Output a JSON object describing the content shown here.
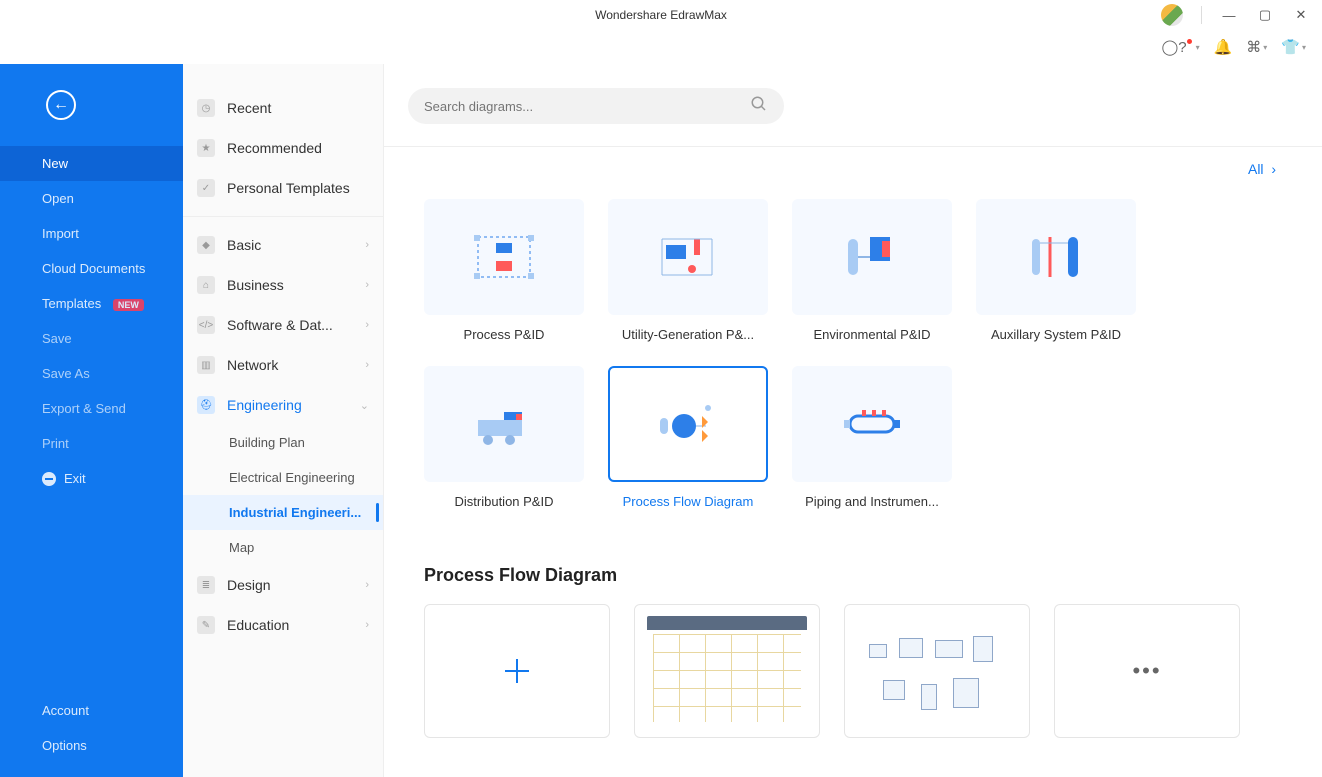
{
  "title": "Wondershare EdrawMax",
  "search": {
    "placeholder": "Search diagrams..."
  },
  "all_link": "All",
  "blueMenu": {
    "new": "New",
    "open": "Open",
    "import": "Import",
    "cloud": "Cloud Documents",
    "templates": "Templates",
    "templates_badge": "NEW",
    "save": "Save",
    "saveas": "Save As",
    "export": "Export & Send",
    "print": "Print",
    "exit": "Exit",
    "account": "Account",
    "options": "Options"
  },
  "catTop": [
    {
      "label": "Recent",
      "icon": "◷"
    },
    {
      "label": "Recommended",
      "icon": "★"
    },
    {
      "label": "Personal Templates",
      "icon": "✓"
    }
  ],
  "catMain": [
    {
      "label": "Basic",
      "icon": "◆"
    },
    {
      "label": "Business",
      "icon": "⌂"
    },
    {
      "label": "Software & Dat...",
      "icon": "</>"
    },
    {
      "label": "Network",
      "icon": "▥"
    },
    {
      "label": "Engineering",
      "icon": "⛑",
      "expanded": true,
      "active": true,
      "children": [
        {
          "label": "Building Plan"
        },
        {
          "label": "Electrical Engineering"
        },
        {
          "label": "Industrial Engineeri...",
          "selected": true
        },
        {
          "label": "Map"
        }
      ]
    },
    {
      "label": "Design",
      "icon": "≣"
    },
    {
      "label": "Education",
      "icon": "✎"
    }
  ],
  "cards": [
    {
      "label": "Process P&ID"
    },
    {
      "label": "Utility-Generation P&...",
      "truncated": true
    },
    {
      "label": "Environmental P&ID"
    },
    {
      "label": "Auxillary System P&ID"
    },
    {
      "label": "Distribution P&ID"
    },
    {
      "label": "Process Flow Diagram",
      "selected": true
    },
    {
      "label": "Piping and Instrumen...",
      "truncated": true
    }
  ],
  "section_title": "Process Flow Diagram"
}
